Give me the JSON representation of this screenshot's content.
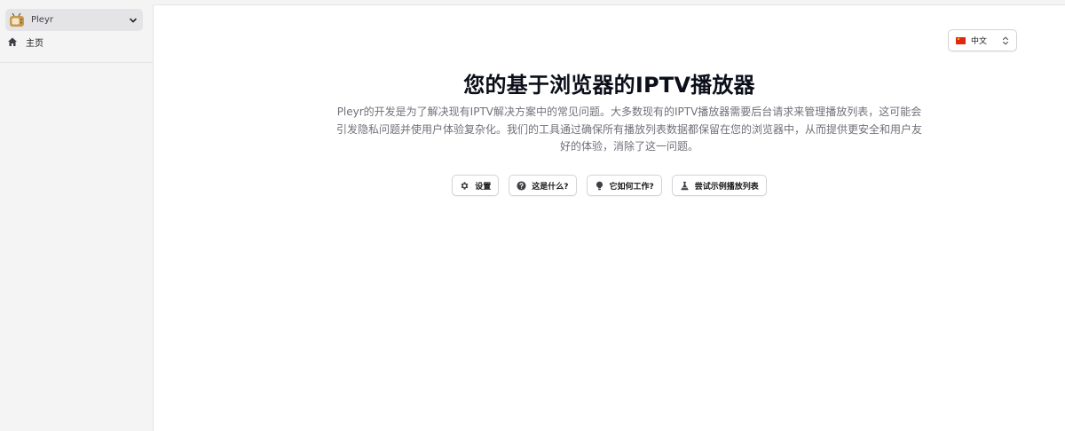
{
  "sidebar": {
    "app_name": "Pleyr",
    "app_logo_icon": "tv-icon",
    "items": [
      {
        "label": "主页",
        "icon": "home-icon"
      }
    ]
  },
  "header": {
    "language": {
      "label": "中文",
      "flag": "china-flag-icon"
    }
  },
  "main": {
    "title": "您的基于浏览器的IPTV播放器",
    "description": "Pleyr的开发是为了解决现有IPTV解决方案中的常见问题。大多数现有的IPTV播放器需要后台请求来管理播放列表，这可能会引发隐私问题并使用户体验复杂化。我们的工具通过确保所有播放列表数据都保留在您的浏览器中，从而提供更安全和用户友好的体验，消除了这一问题。",
    "actions": [
      {
        "label": "设置",
        "icon": "gear-icon"
      },
      {
        "label": "这是什么?",
        "icon": "question-icon"
      },
      {
        "label": "它如何工作?",
        "icon": "lightbulb-icon"
      },
      {
        "label": "尝试示例播放列表",
        "icon": "flask-icon"
      }
    ]
  },
  "colors": {
    "accent_logo": "#c79a52",
    "text_primary": "#0b0f19",
    "text_muted": "#71717a",
    "sidebar_bg": "#f4f4f5"
  }
}
